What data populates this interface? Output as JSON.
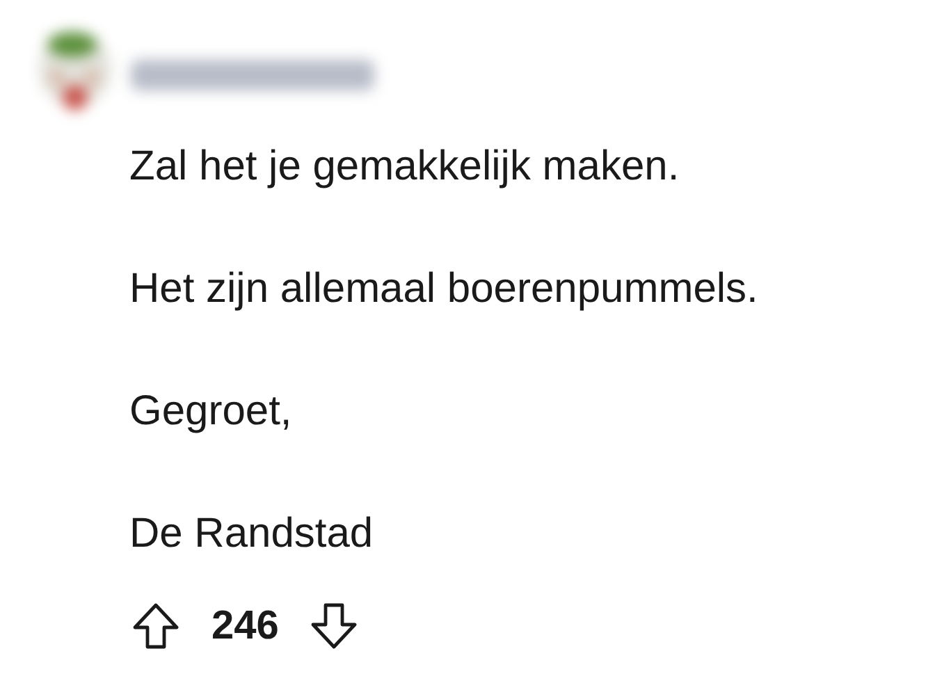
{
  "comment": {
    "paragraphs": [
      "Zal het je gemakkelijk maken.",
      "Het zijn allemaal boerenpummels.",
      "Gegroet,",
      "De Randstad"
    ],
    "score": "246"
  }
}
